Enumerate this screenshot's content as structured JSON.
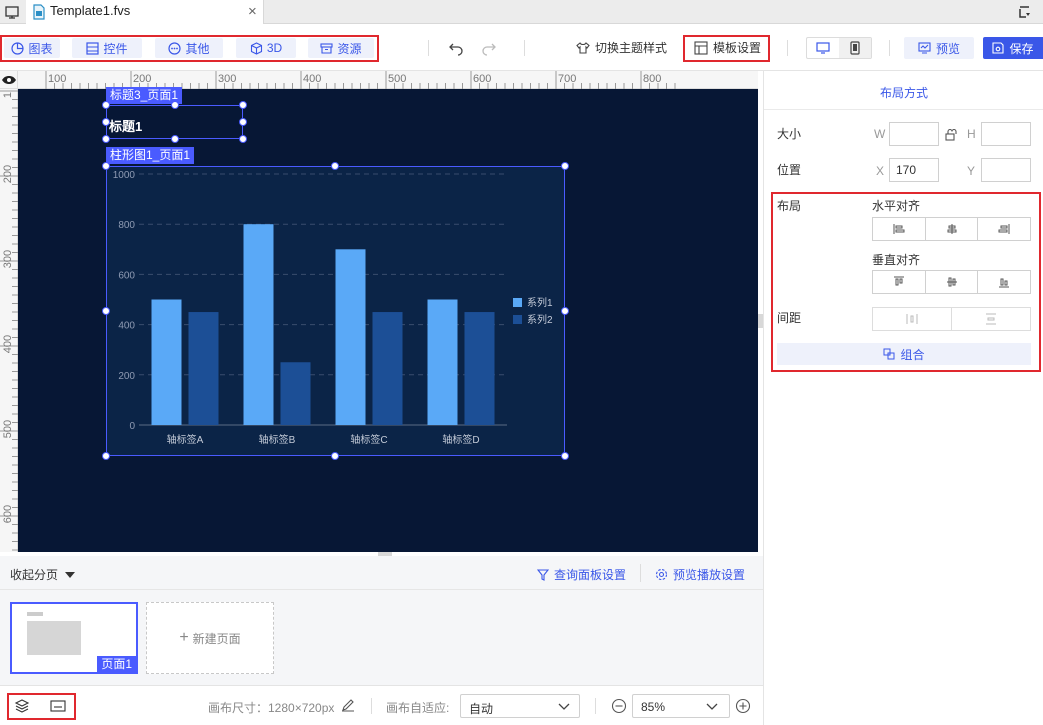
{
  "tab": {
    "title": "Template1.fvs",
    "close": "×"
  },
  "toolbar": {
    "groups": [
      {
        "label": "图表"
      },
      {
        "label": "控件"
      },
      {
        "label": "其他"
      },
      {
        "label": "3D"
      },
      {
        "label": "资源"
      }
    ],
    "theme_label": "切换主题样式",
    "template_label": "模板设置",
    "preview_label": "预览",
    "save_label": "保存"
  },
  "ruler": {
    "top": [
      "100",
      "200",
      "300",
      "400",
      "500",
      "600",
      "700",
      "800"
    ],
    "left": [
      "1",
      "200",
      "300",
      "400",
      "500",
      "600"
    ]
  },
  "canvas": {
    "title_tag": "标题3_页面1",
    "title_text": "标题1",
    "chart_tag": "柱形图1_页面1"
  },
  "chart_data": {
    "type": "bar",
    "categories": [
      "轴标签A",
      "轴标签B",
      "轴标签C",
      "轴标签D"
    ],
    "series": [
      {
        "name": "系列1",
        "values": [
          500,
          800,
          700,
          500
        ],
        "color": "#5aa9f7"
      },
      {
        "name": "系列2",
        "values": [
          450,
          250,
          450,
          450
        ],
        "color": "#1c4f96"
      }
    ],
    "ylim": [
      0,
      1000
    ],
    "yticks": [
      "0",
      "200",
      "400",
      "600",
      "800",
      "1000"
    ],
    "grid": true,
    "legend": "right"
  },
  "pages": {
    "collapse_label": "收起分页",
    "query_settings": "查询面板设置",
    "play_settings": "预览播放设置",
    "page_label": "页面1",
    "new_page": "新建页面"
  },
  "status": {
    "canvas_size_label": "画布尺寸：1280×720px",
    "adapt_label": "画布自适应:",
    "adapt_value": "自动",
    "zoom_value": "85%"
  },
  "panel": {
    "title": "布局方式",
    "size_label": "大小",
    "w_label": "W",
    "h_label": "H",
    "w_value": "",
    "h_value": "",
    "pos_label": "位置",
    "x_label": "X",
    "y_label": "Y",
    "x_value": "170",
    "y_value": "",
    "layout_label": "布局",
    "h_align_label": "水平对齐",
    "v_align_label": "垂直对齐",
    "spacing_label": "间距",
    "group_label": "组合"
  },
  "colors": {
    "accent": "#3a57e8",
    "canvas_bg": "#071735",
    "highlight": "#e0282e"
  }
}
